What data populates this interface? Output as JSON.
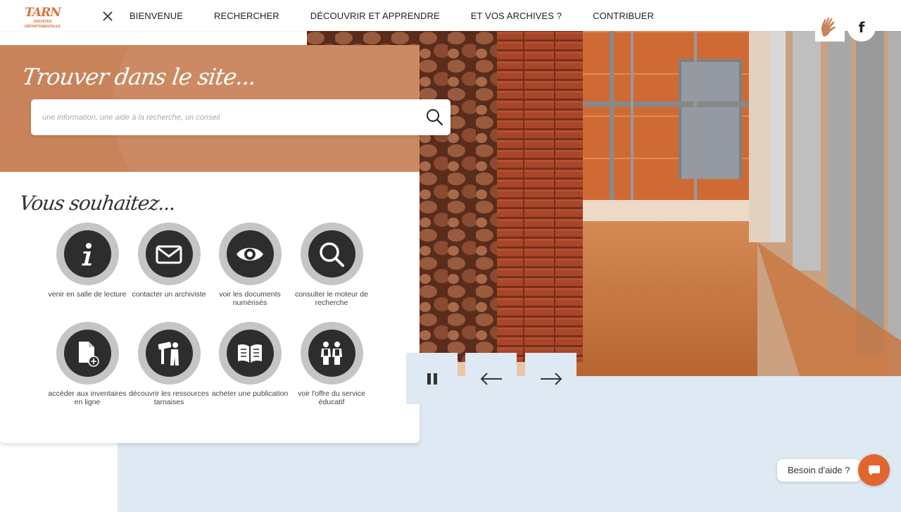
{
  "logo": {
    "name": "TARN",
    "subtitle": "ARCHIVES DÉPARTEMENTALES"
  },
  "nav": {
    "items": [
      {
        "label": "BIENVENUE"
      },
      {
        "label": "RECHERCHER"
      },
      {
        "label": "DÉCOUVRIR ET APPRENDRE"
      },
      {
        "label": "ET VOS ARCHIVES ?"
      },
      {
        "label": "CONTRIBUER"
      }
    ]
  },
  "social": {
    "facebook_glyph": "f"
  },
  "search": {
    "title": "Trouver dans le site...",
    "placeholder": "une information, une aide à la recherche, un conseil",
    "value": ""
  },
  "options": {
    "title": "Vous souhaitez...",
    "items": [
      {
        "label": "venir en salle de lecture",
        "icon": "info-icon"
      },
      {
        "label": "contacter un archiviste",
        "icon": "envelope-icon"
      },
      {
        "label": "voir les documents numérisés",
        "icon": "eye-icon"
      },
      {
        "label": "consulter le moteur de recherche",
        "icon": "magnifier-icon"
      },
      {
        "label": "accéder aux inventaires en ligne",
        "icon": "document-plus-icon"
      },
      {
        "label": "découvrir les ressources tarnaises",
        "icon": "person-with-telescope-icon"
      },
      {
        "label": "acheter une publication",
        "icon": "open-book-icon"
      },
      {
        "label": "voir l'offre du service éducatif",
        "icon": "children-icon"
      }
    ]
  },
  "help": {
    "label": "Besoin d'aide ?"
  },
  "colors": {
    "accent": "#e0662e",
    "search_panel": "#c8835a",
    "icon_ring": "#c5c5c5",
    "icon_core": "#2d2d2d",
    "light_blue": "#dfe9f3"
  }
}
